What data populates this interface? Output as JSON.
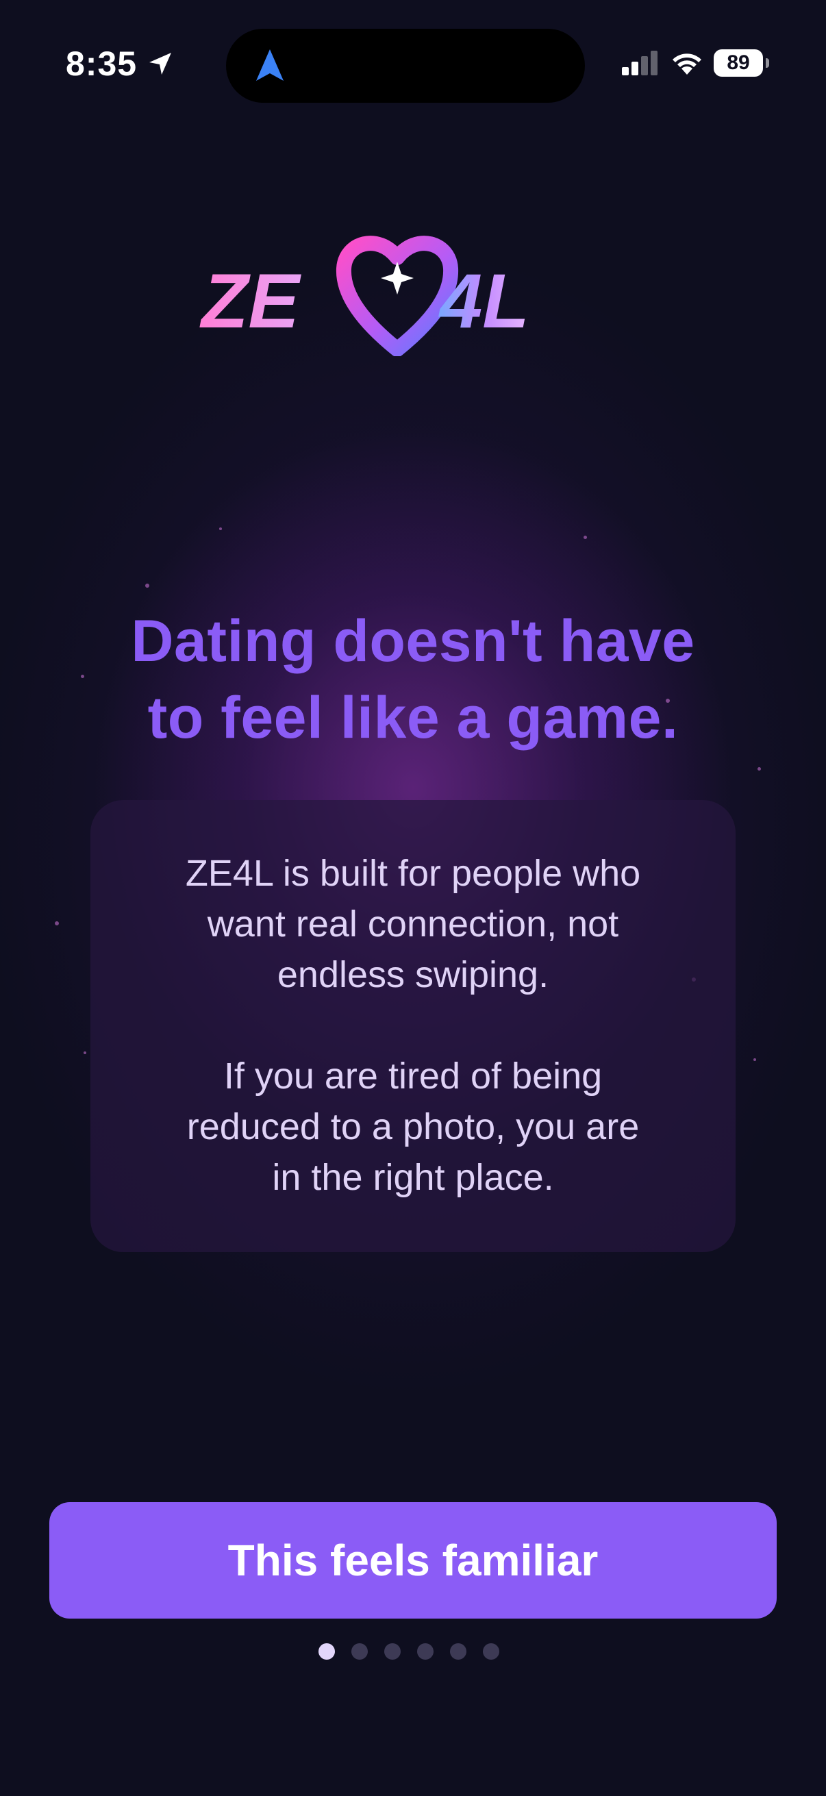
{
  "status_bar": {
    "time": "8:35",
    "battery": "89",
    "icons": [
      "location-arrow-icon",
      "navigation-icon",
      "cellular-signal-icon",
      "wifi-icon",
      "battery-icon"
    ]
  },
  "logo": {
    "text_left": "ZE",
    "text_right": "4L",
    "icon": "heart-logo-icon"
  },
  "headline": {
    "line1": "Dating doesn't have",
    "line2": "to feel like a game."
  },
  "card": {
    "para1": [
      "ZE4L is built for people who",
      "want real connection, not",
      "endless swiping."
    ],
    "para2": [
      "If you are tired of being",
      "reduced to a photo, you are",
      "in the right place."
    ]
  },
  "cta": {
    "label": "This feels familiar"
  },
  "pagination": {
    "total": 6,
    "current": 1
  },
  "colors": {
    "accent": "#8b5cf6",
    "background": "#0e0e1f",
    "card_text": "#e0d3f7"
  }
}
